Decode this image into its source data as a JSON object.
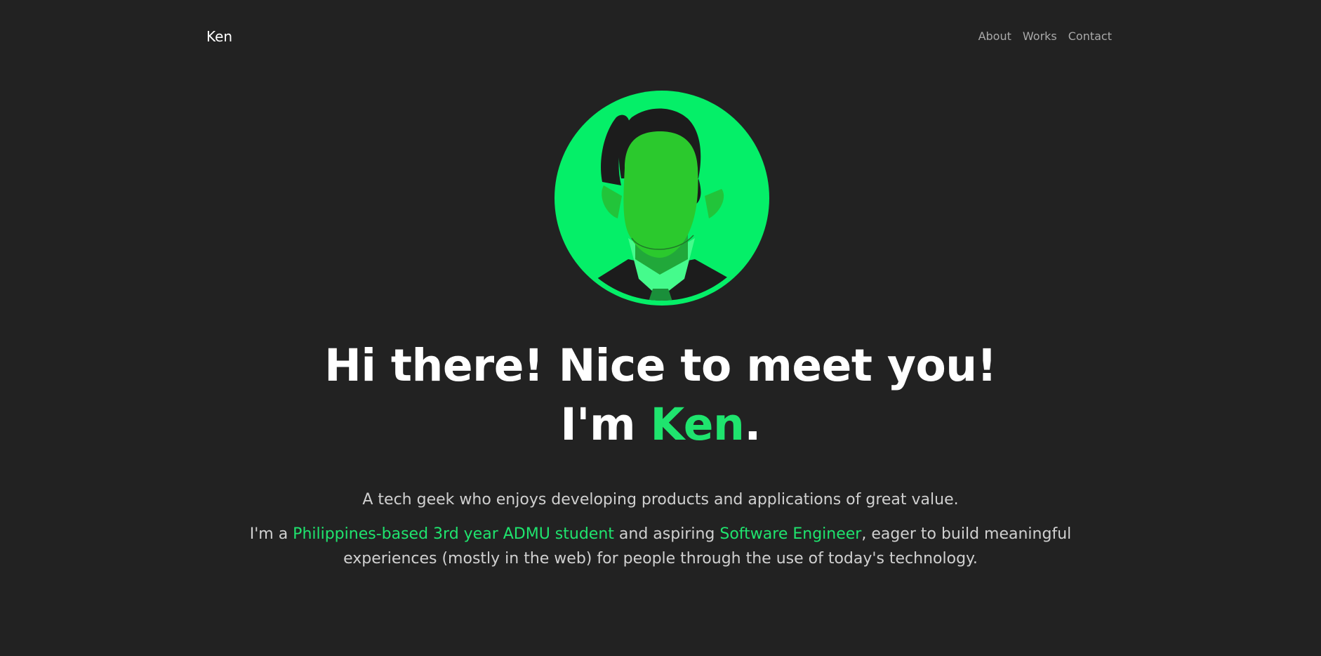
{
  "header": {
    "brand": "Ken",
    "nav": [
      {
        "label": "About"
      },
      {
        "label": "Works"
      },
      {
        "label": "Contact"
      }
    ]
  },
  "hero": {
    "headline_line1": "Hi there! Nice to meet you!",
    "headline_prefix": "I'm ",
    "headline_name": "Ken",
    "headline_suffix": ".",
    "tagline": "A tech geek who enjoys developing products and applications of great value.",
    "bio": {
      "p1": "I'm a ",
      "h1": "Philippines-based 3rd year ADMU student",
      "p2": " and aspiring ",
      "h2": "Software Engineer",
      "p3": ", eager to build meaningful experiences (mostly in the web) for people through the use of today's technology."
    }
  },
  "colors": {
    "background": "#222222",
    "accent": "#1fe46e",
    "avatar_circle": "#05ef68",
    "text_muted": "#d0d0d0",
    "nav_text": "#a9a9a9"
  }
}
